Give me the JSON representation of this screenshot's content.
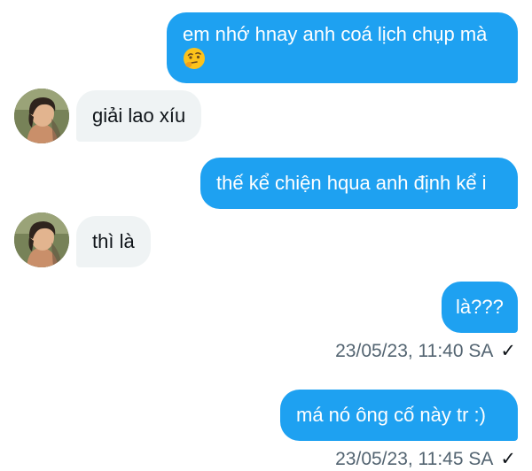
{
  "conversation": {
    "messages": [
      {
        "direction": "outgoing",
        "text": "em nhớ hnay anh coá lịch chụp mà",
        "emoji": "thinking-face-emoji"
      },
      {
        "direction": "incoming",
        "text": "giải lao xíu",
        "avatar": "contact-avatar"
      },
      {
        "direction": "outgoing",
        "text": "thế kể chiện hqua anh định kể i"
      },
      {
        "direction": "incoming",
        "text": "thì là",
        "avatar": "contact-avatar"
      },
      {
        "direction": "outgoing",
        "text": "là???",
        "timestamp": "23/05/23, 11:40 SA",
        "status_icon": "sent-check-icon"
      },
      {
        "direction": "outgoing",
        "text": "má nó ông cố này tr :)",
        "timestamp": "23/05/23, 11:45 SA",
        "status_icon": "sent-check-icon"
      }
    ],
    "check_glyph": "✓"
  },
  "colors": {
    "outgoing_bubble": "#1ea1f1",
    "incoming_bubble": "#eff3f4",
    "timestamp_text": "#536471"
  }
}
